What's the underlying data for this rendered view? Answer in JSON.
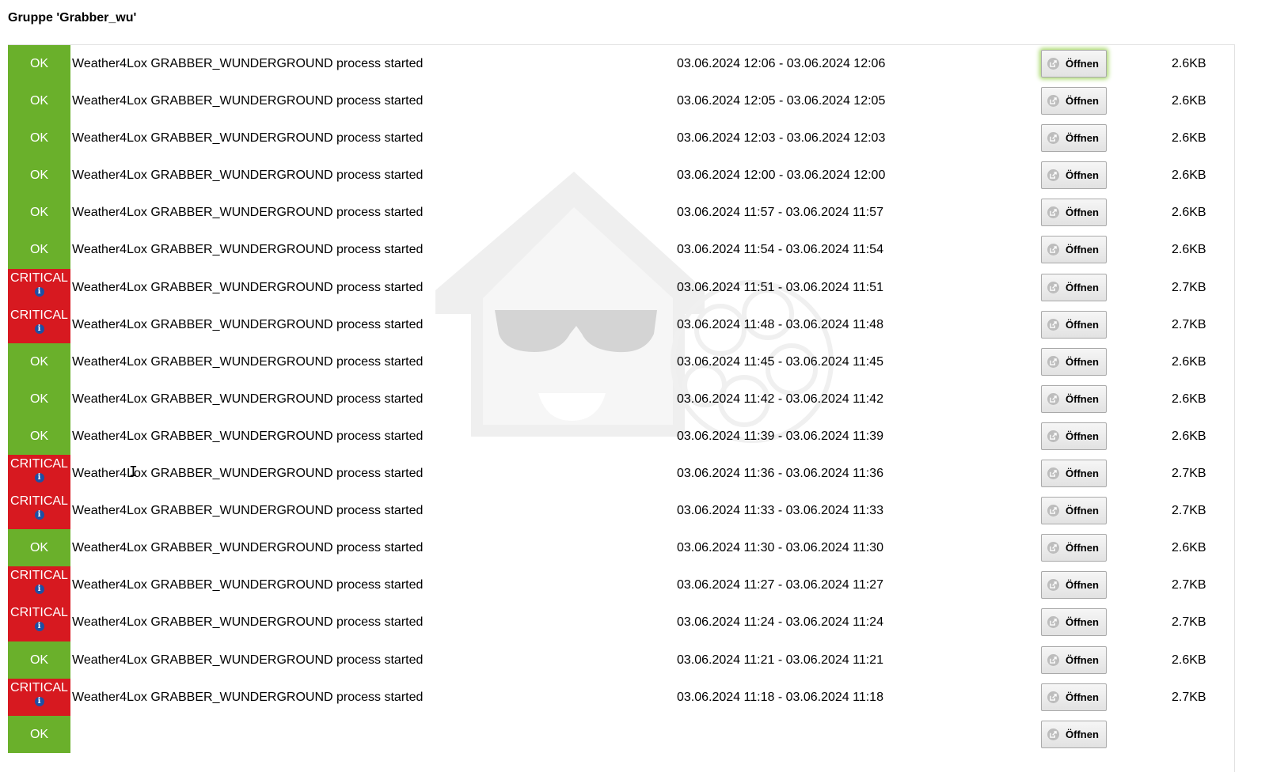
{
  "group_title": "Gruppe 'Grabber_wu'",
  "open_label": "Öffnen",
  "rows": [
    {
      "status": "OK",
      "message": "Weather4Lox GRABBER_WUNDERGROUND process started",
      "time": "03.06.2024 12:06 - 03.06.2024 12:06",
      "size": "2.6KB"
    },
    {
      "status": "OK",
      "message": "Weather4Lox GRABBER_WUNDERGROUND process started",
      "time": "03.06.2024 12:05 - 03.06.2024 12:05",
      "size": "2.6KB"
    },
    {
      "status": "OK",
      "message": "Weather4Lox GRABBER_WUNDERGROUND process started",
      "time": "03.06.2024 12:03 - 03.06.2024 12:03",
      "size": "2.6KB"
    },
    {
      "status": "OK",
      "message": "Weather4Lox GRABBER_WUNDERGROUND process started",
      "time": "03.06.2024 12:00 - 03.06.2024 12:00",
      "size": "2.6KB"
    },
    {
      "status": "OK",
      "message": "Weather4Lox GRABBER_WUNDERGROUND process started",
      "time": "03.06.2024 11:57 - 03.06.2024 11:57",
      "size": "2.6KB"
    },
    {
      "status": "OK",
      "message": "Weather4Lox GRABBER_WUNDERGROUND process started",
      "time": "03.06.2024 11:54 - 03.06.2024 11:54",
      "size": "2.6KB"
    },
    {
      "status": "CRITICAL",
      "message": "Weather4Lox GRABBER_WUNDERGROUND process started",
      "time": "03.06.2024 11:51 - 03.06.2024 11:51",
      "size": "2.7KB"
    },
    {
      "status": "CRITICAL",
      "message": "Weather4Lox GRABBER_WUNDERGROUND process started",
      "time": "03.06.2024 11:48 - 03.06.2024 11:48",
      "size": "2.7KB"
    },
    {
      "status": "OK",
      "message": "Weather4Lox GRABBER_WUNDERGROUND process started",
      "time": "03.06.2024 11:45 - 03.06.2024 11:45",
      "size": "2.6KB"
    },
    {
      "status": "OK",
      "message": "Weather4Lox GRABBER_WUNDERGROUND process started",
      "time": "03.06.2024 11:42 - 03.06.2024 11:42",
      "size": "2.6KB"
    },
    {
      "status": "OK",
      "message": "Weather4Lox GRABBER_WUNDERGROUND process started",
      "time": "03.06.2024 11:39 - 03.06.2024 11:39",
      "size": "2.6KB"
    },
    {
      "status": "CRITICAL",
      "message": "Weather4Lox GRABBER_WUNDERGROUND process started",
      "time": "03.06.2024 11:36 - 03.06.2024 11:36",
      "size": "2.7KB"
    },
    {
      "status": "CRITICAL",
      "message": "Weather4Lox GRABBER_WUNDERGROUND process started",
      "time": "03.06.2024 11:33 - 03.06.2024 11:33",
      "size": "2.7KB"
    },
    {
      "status": "OK",
      "message": "Weather4Lox GRABBER_WUNDERGROUND process started",
      "time": "03.06.2024 11:30 - 03.06.2024 11:30",
      "size": "2.6KB"
    },
    {
      "status": "CRITICAL",
      "message": "Weather4Lox GRABBER_WUNDERGROUND process started",
      "time": "03.06.2024 11:27 - 03.06.2024 11:27",
      "size": "2.7KB"
    },
    {
      "status": "CRITICAL",
      "message": "Weather4Lox GRABBER_WUNDERGROUND process started",
      "time": "03.06.2024 11:24 - 03.06.2024 11:24",
      "size": "2.7KB"
    },
    {
      "status": "OK",
      "message": "Weather4Lox GRABBER_WUNDERGROUND process started",
      "time": "03.06.2024 11:21 - 03.06.2024 11:21",
      "size": "2.6KB"
    },
    {
      "status": "CRITICAL",
      "message": "Weather4Lox GRABBER_WUNDERGROUND process started",
      "time": "03.06.2024 11:18 - 03.06.2024 11:18",
      "size": "2.7KB"
    },
    {
      "status": "OK",
      "message": "",
      "time": "",
      "size": ""
    }
  ],
  "colors": {
    "ok": "#6ab02b",
    "critical": "#d71920",
    "info": "#1e4fa3"
  },
  "icons": {
    "watermark": "house-sunglasses-logo-icon",
    "button": "open-external-icon",
    "info": "info-icon"
  }
}
